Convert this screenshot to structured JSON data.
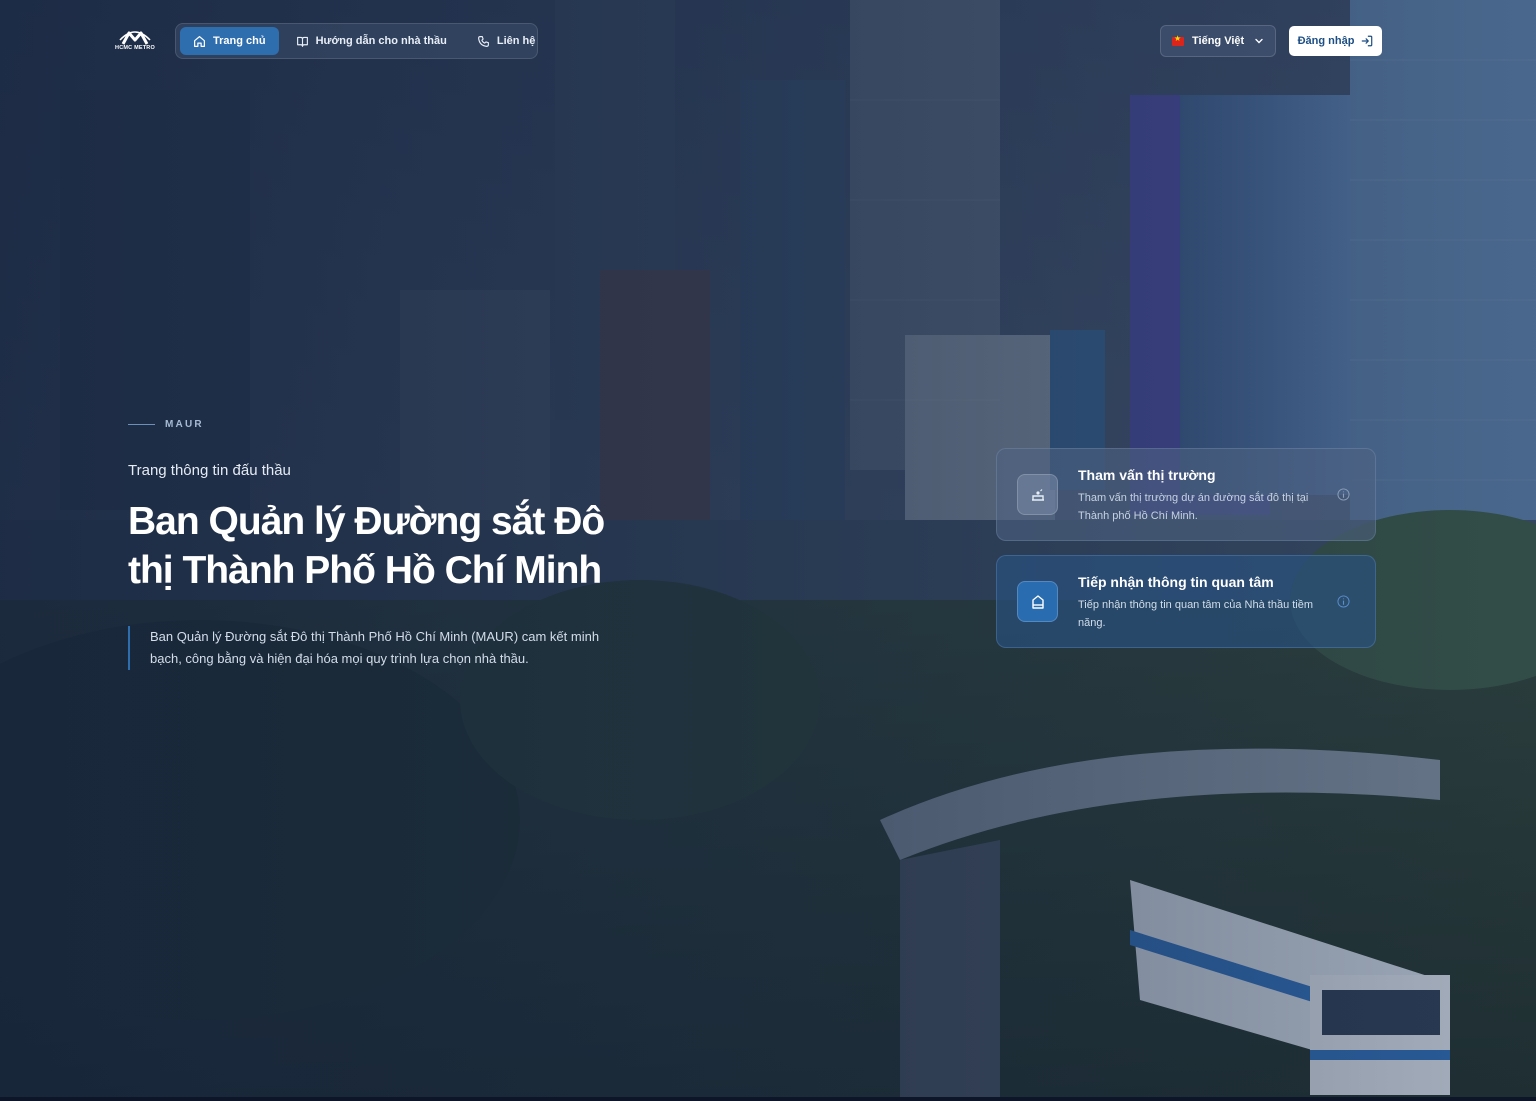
{
  "brand": {
    "logo_text": "HCMC METRO"
  },
  "nav": {
    "items": [
      {
        "label": "Trang chủ",
        "icon": "home-icon",
        "active": true
      },
      {
        "label": "Hướng dẫn cho nhà thầu",
        "icon": "book-icon",
        "active": false
      },
      {
        "label": "Liên hệ",
        "icon": "phone-icon",
        "active": false
      }
    ]
  },
  "language": {
    "selected": "Tiếng Việt",
    "flag": "vietnam-flag-icon"
  },
  "login": {
    "label": "Đăng nhập",
    "icon": "login-icon"
  },
  "hero": {
    "eyebrow": "MAUR",
    "subtitle": "Trang thông tin đấu thầu",
    "headline": "Ban Quản lý Đường sắt Đô thị Thành Phố Hồ Chí Minh",
    "description": "Ban Quản lý Đường sắt Đô thị Thành Phố Hồ Chí Minh (MAUR) cam kết minh bạch, công bằng và hiện đại hóa mọi quy trình lựa chọn nhà thầu."
  },
  "cards": [
    {
      "title": "Tham vấn thị trường",
      "text": "Tham vấn thị trường dự án đường sắt đô thị tại Thành phố Hồ Chí Minh.",
      "icon": "market-consult-icon"
    },
    {
      "title": "Tiếp nhận thông tin quan tâm",
      "text": "Tiếp nhận thông tin quan tâm của Nhà thầu tiềm năng.",
      "icon": "inbox-icon"
    }
  ],
  "colors": {
    "accent": "#2e6dae",
    "overlay": "#16243e",
    "login_text": "#1d4e84"
  }
}
